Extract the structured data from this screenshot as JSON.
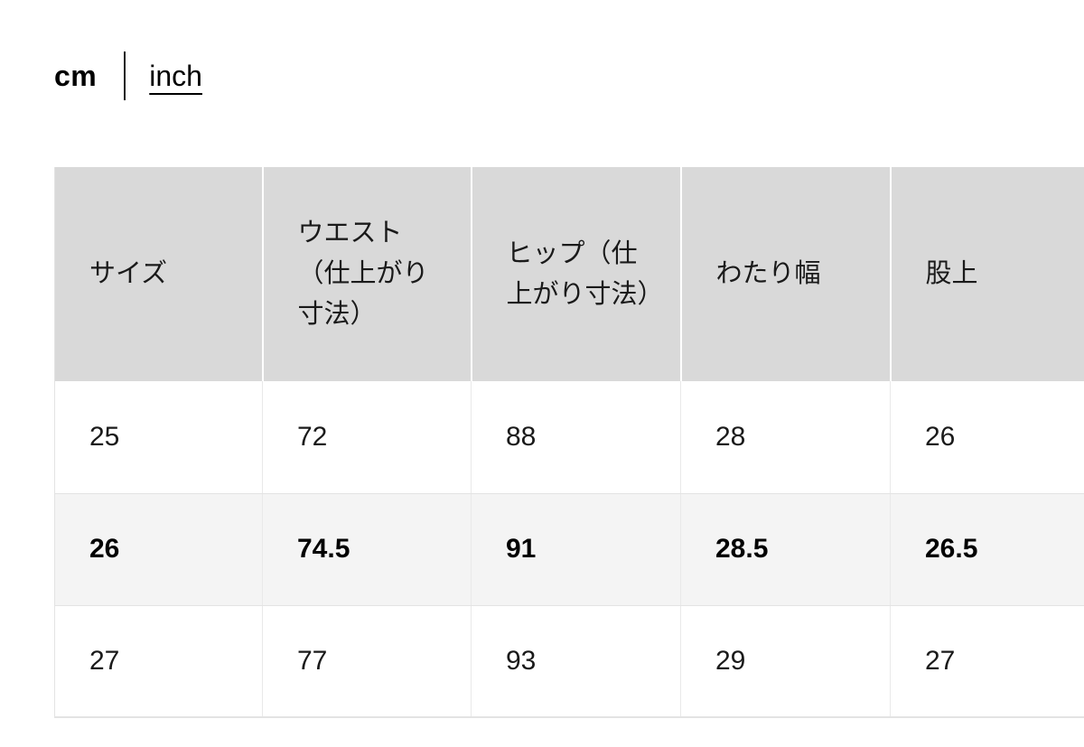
{
  "unit_toggle": {
    "active_label": "cm",
    "alt_label": "inch"
  },
  "size_table": {
    "headers": [
      "サイズ",
      "ウエスト（仕上がり寸法）",
      "ヒップ（仕上がり寸法）",
      "わたり幅",
      "股上"
    ],
    "rows": [
      {
        "highlighted": false,
        "cells": [
          "25",
          "72",
          "88",
          "28",
          "26"
        ]
      },
      {
        "highlighted": true,
        "cells": [
          "26",
          "74.5",
          "91",
          "28.5",
          "26.5"
        ]
      },
      {
        "highlighted": false,
        "cells": [
          "27",
          "77",
          "93",
          "29",
          "27"
        ]
      }
    ]
  },
  "colors": {
    "header_bg": "#d9d9d9",
    "highlight_row_bg": "#f4f4f4",
    "border": "#e3e3e3",
    "text": "#1a1a1a"
  }
}
